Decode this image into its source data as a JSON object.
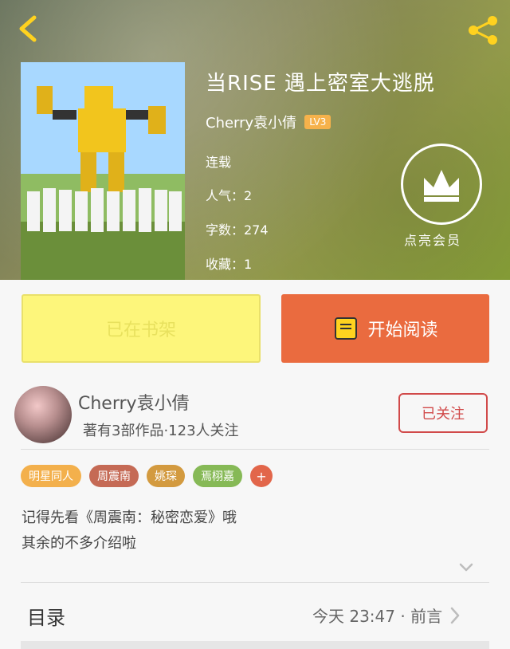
{
  "header": {
    "back_icon": "chevron-left-icon",
    "share_icon": "share-icon",
    "cover_alt": "",
    "title": "当RISE 遇上密室大逃脱",
    "author": "Cherry袁小倩",
    "level_badge": "LV3",
    "status": "连载",
    "popularity": "人气：2",
    "word_count": "字数：274",
    "favorites": "收藏：1",
    "vip_label": "点亮会员"
  },
  "actions": {
    "shelf_label": "已在书架",
    "read_label": "开始阅读"
  },
  "author_card": {
    "name": "Cherry袁小倩",
    "stats": "著有3部作品·123人关注",
    "follow_label": "已关注"
  },
  "tags": [
    "明星同人",
    "周震南",
    "姚琛",
    "焉栩嘉",
    "+"
  ],
  "description": {
    "line1": "记得先看《周震南：秘密恋爱》哦",
    "line2": "其余的不多介绍啦"
  },
  "toc": {
    "title": "目录",
    "latest": "今天 23:47 · 前言"
  },
  "colors": {
    "accent_orange": "#ea6b3f",
    "shelf_yellow": "#fdf67b",
    "follow_red": "#d14a4a"
  }
}
